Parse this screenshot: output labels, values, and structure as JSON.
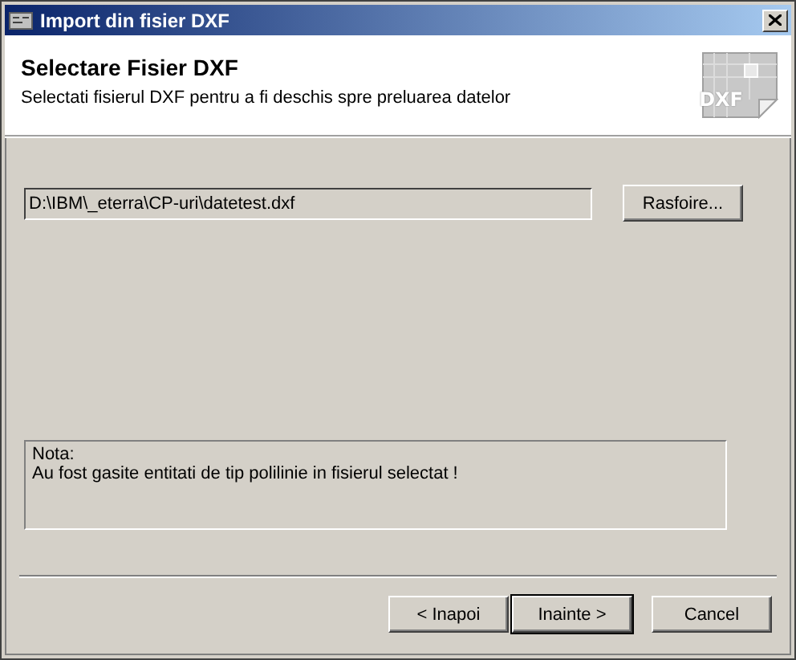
{
  "window": {
    "title": "Import din fisier DXF"
  },
  "header": {
    "title": "Selectare Fisier DXF",
    "subtitle": "Selectati fisierul DXF pentru a fi deschis spre preluarea datelor",
    "icon_label": "DXF"
  },
  "file": {
    "value": "D:\\IBM\\_eterra\\CP-uri\\datetest.dxf",
    "browse": "Rasfoire..."
  },
  "note": {
    "label": "Nota:",
    "text": "Au fost gasite entitati de tip polilinie in fisierul selectat !"
  },
  "buttons": [
    {
      "label": "< Inapoi",
      "default": false
    },
    {
      "label": "Inainte >",
      "default": true
    },
    {
      "label": "Cancel",
      "default": false
    }
  ]
}
